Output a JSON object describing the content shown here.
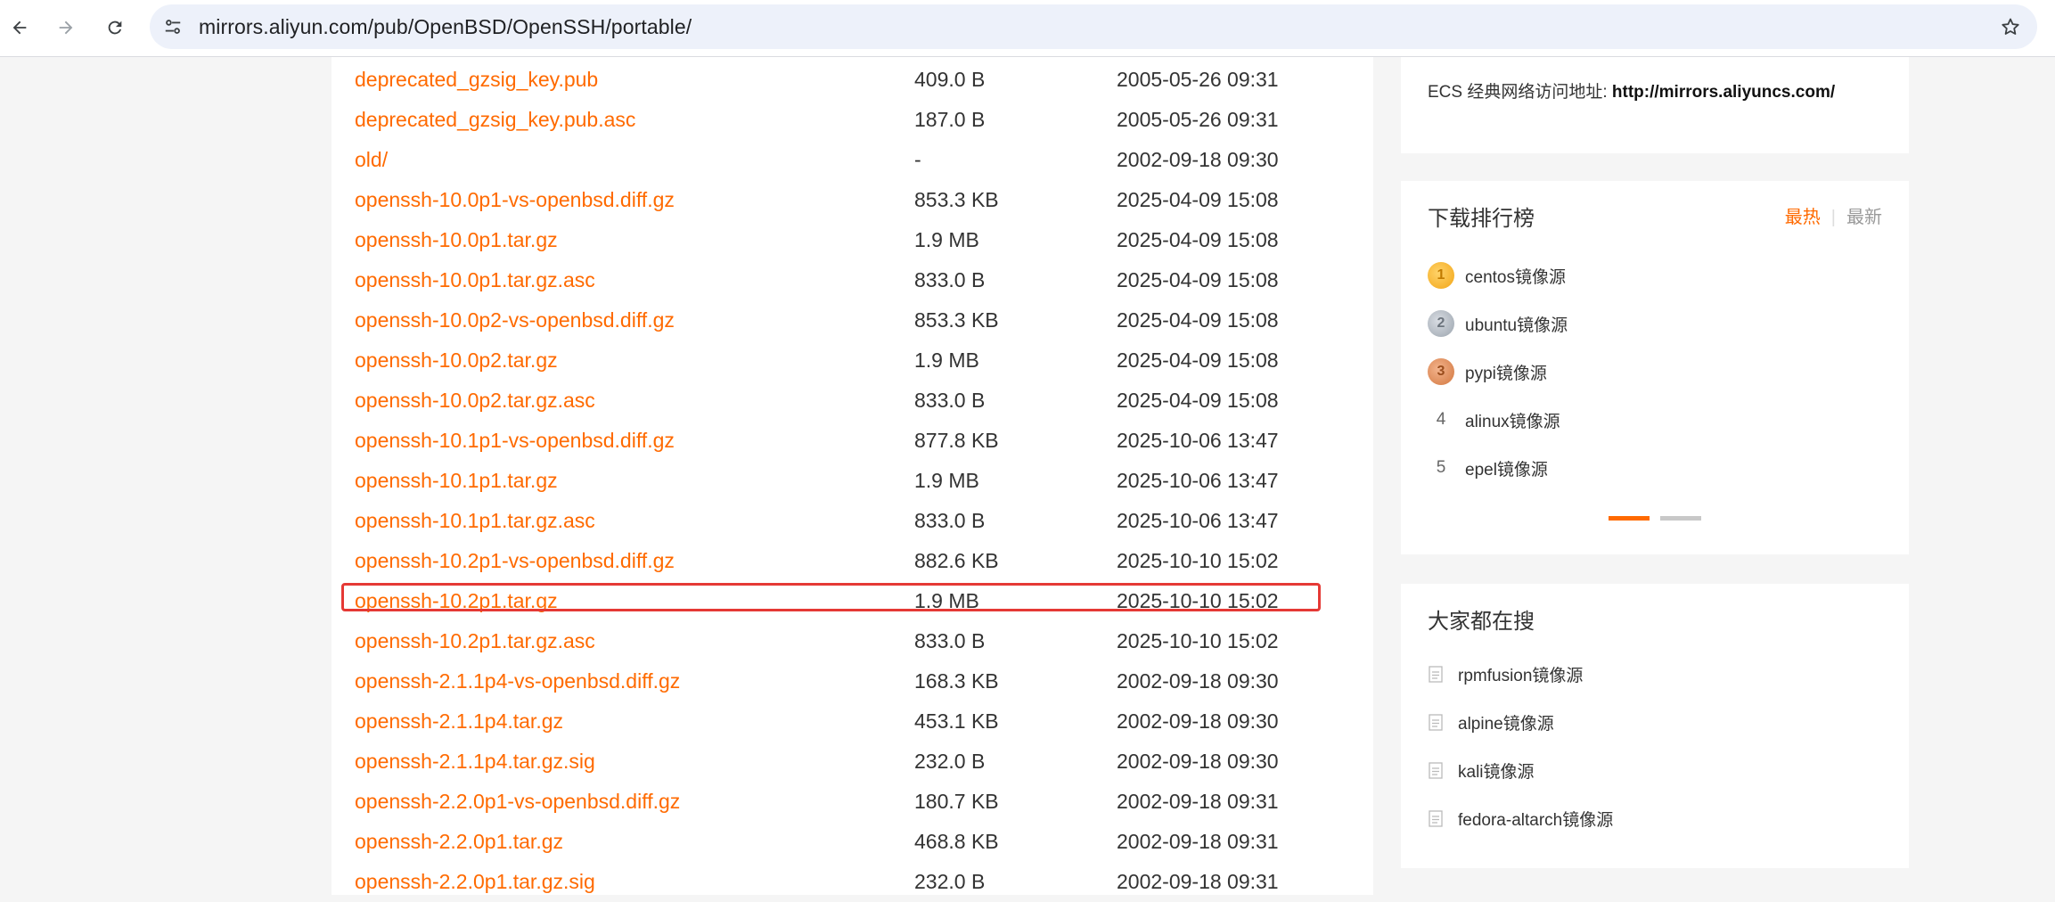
{
  "browser": {
    "url": "mirrors.aliyun.com/pub/OpenBSD/OpenSSH/portable/",
    "back_icon": "arrow-left-icon",
    "forward_icon": "arrow-right-icon",
    "reload_icon": "reload-icon",
    "site_info_icon": "tune-icon",
    "bookmark_icon": "star-icon"
  },
  "listing": {
    "link_color": "#ff6a00",
    "rows": [
      {
        "name": "deprecated_gzsig_key.pub",
        "size": "409.0 B",
        "date": "2005-05-26 09:31"
      },
      {
        "name": "deprecated_gzsig_key.pub.asc",
        "size": "187.0 B",
        "date": "2005-05-26 09:31"
      },
      {
        "name": "old/",
        "size": "-",
        "date": "2002-09-18 09:30"
      },
      {
        "name": "openssh-10.0p1-vs-openbsd.diff.gz",
        "size": "853.3 KB",
        "date": "2025-04-09 15:08"
      },
      {
        "name": "openssh-10.0p1.tar.gz",
        "size": "1.9 MB",
        "date": "2025-04-09 15:08"
      },
      {
        "name": "openssh-10.0p1.tar.gz.asc",
        "size": "833.0 B",
        "date": "2025-04-09 15:08"
      },
      {
        "name": "openssh-10.0p2-vs-openbsd.diff.gz",
        "size": "853.3 KB",
        "date": "2025-04-09 15:08"
      },
      {
        "name": "openssh-10.0p2.tar.gz",
        "size": "1.9 MB",
        "date": "2025-04-09 15:08"
      },
      {
        "name": "openssh-10.0p2.tar.gz.asc",
        "size": "833.0 B",
        "date": "2025-04-09 15:08"
      },
      {
        "name": "openssh-10.1p1-vs-openbsd.diff.gz",
        "size": "877.8 KB",
        "date": "2025-10-06 13:47"
      },
      {
        "name": "openssh-10.1p1.tar.gz",
        "size": "1.9 MB",
        "date": "2025-10-06 13:47"
      },
      {
        "name": "openssh-10.1p1.tar.gz.asc",
        "size": "833.0 B",
        "date": "2025-10-06 13:47"
      },
      {
        "name": "openssh-10.2p1-vs-openbsd.diff.gz",
        "size": "882.6 KB",
        "date": "2025-10-10 15:02"
      },
      {
        "name": "openssh-10.2p1.tar.gz",
        "size": "1.9 MB",
        "date": "2025-10-10 15:02"
      },
      {
        "name": "openssh-10.2p1.tar.gz.asc",
        "size": "833.0 B",
        "date": "2025-10-10 15:02"
      },
      {
        "name": "openssh-2.1.1p4-vs-openbsd.diff.gz",
        "size": "168.3 KB",
        "date": "2002-09-18 09:30"
      },
      {
        "name": "openssh-2.1.1p4.tar.gz",
        "size": "453.1 KB",
        "date": "2002-09-18 09:30"
      },
      {
        "name": "openssh-2.1.1p4.tar.gz.sig",
        "size": "232.0 B",
        "date": "2002-09-18 09:30"
      },
      {
        "name": "openssh-2.2.0p1-vs-openbsd.diff.gz",
        "size": "180.7 KB",
        "date": "2002-09-18 09:31"
      },
      {
        "name": "openssh-2.2.0p1.tar.gz",
        "size": "468.8 KB",
        "date": "2002-09-18 09:31"
      },
      {
        "name": "openssh-2.2.0p1.tar.gz.sig",
        "size": "232.0 B",
        "date": "2002-09-18 09:31"
      }
    ],
    "highlight_color": "#e53935"
  },
  "ecs": {
    "label": "ECS 经典网络访问地址: ",
    "url": "http://mirrors.aliyuncs.com/"
  },
  "ranking": {
    "title": "下载排行榜",
    "tab_hot": "最热",
    "tab_sep": "|",
    "tab_new": "最新",
    "accent_color": "#ff6a00",
    "items": [
      {
        "rank": "1",
        "label": "centos镜像源",
        "medal": "gold-medal-icon"
      },
      {
        "rank": "2",
        "label": "ubuntu镜像源",
        "medal": "silver-medal-icon"
      },
      {
        "rank": "3",
        "label": "pypi镜像源",
        "medal": "bronze-medal-icon"
      },
      {
        "rank": "4",
        "label": "alinux镜像源"
      },
      {
        "rank": "5",
        "label": "epel镜像源"
      }
    ]
  },
  "popular": {
    "title": "大家都在搜",
    "items": [
      {
        "label": "rpmfusion镜像源",
        "icon": "document-icon"
      },
      {
        "label": "alpine镜像源",
        "icon": "document-icon"
      },
      {
        "label": "kali镜像源",
        "icon": "document-icon"
      },
      {
        "label": "fedora-altarch镜像源",
        "icon": "document-icon"
      }
    ]
  }
}
